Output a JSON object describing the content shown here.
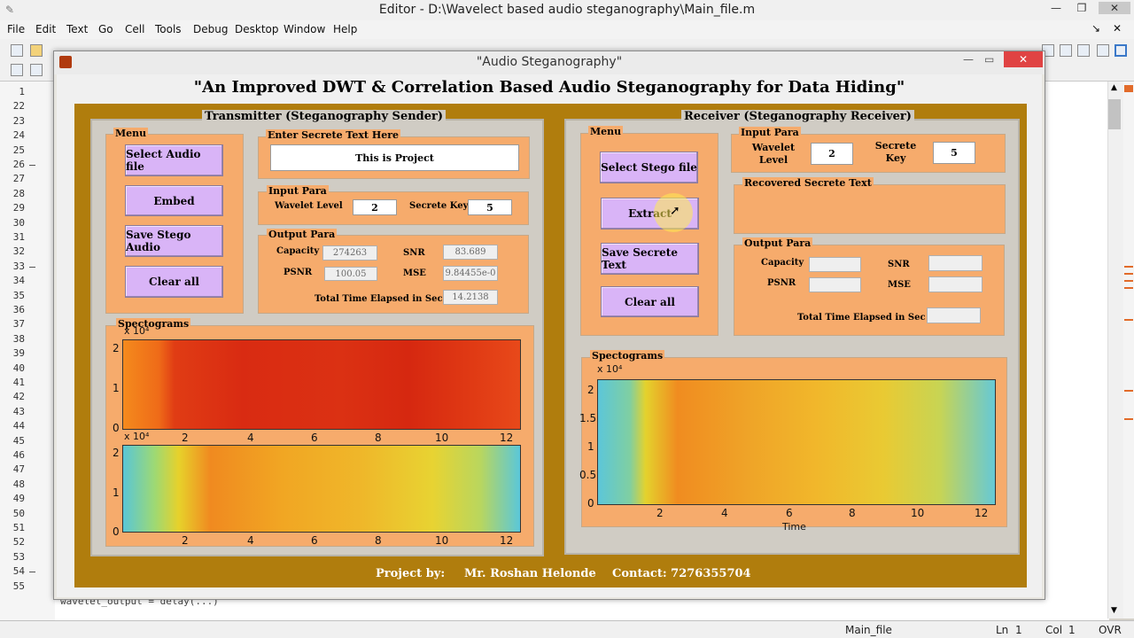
{
  "editor": {
    "title": "Editor - D:\\Wavelect based audio steganography\\Main_file.m",
    "menu": [
      "File",
      "Edit",
      "Text",
      "Go",
      "Cell",
      "Tools",
      "Debug",
      "Desktop",
      "Window",
      "Help"
    ],
    "line_numbers": [
      "1",
      "22",
      "23",
      "24",
      "25",
      "26",
      "27",
      "28",
      "29",
      "30",
      "31",
      "32",
      "33",
      "34",
      "35",
      "36",
      "37",
      "38",
      "39",
      "40",
      "41",
      "42",
      "43",
      "44",
      "45",
      "46",
      "47",
      "48",
      "49",
      "50",
      "51",
      "52",
      "53",
      "54",
      "55"
    ],
    "code_fragment": "wavelet_output = delay(...)",
    "status": {
      "file": "Main_file",
      "ln_label": "Ln",
      "ln": "1",
      "col_label": "Col",
      "col": "1",
      "mode": "OVR"
    }
  },
  "figure": {
    "title": "\"Audio Steganography\"",
    "headline": "\"An Improved DWT & Correlation Based Audio Steganography for Data Hiding\""
  },
  "transmitter": {
    "title": "Transmitter (Steganography Sender)",
    "menu_title": "Menu",
    "buttons": [
      "Select Audio file",
      "Embed",
      "Save Stego Audio",
      "Clear all"
    ],
    "secret_title": "Enter Secrete Text Here",
    "secret_text": "This is Project",
    "input_title": "Input Para",
    "wavelet_label": "Wavelet Level",
    "wavelet_value": "2",
    "key_label": "Secrete Key",
    "key_value": "5",
    "output_title": "Output Para",
    "capacity_label": "Capacity",
    "capacity_value": "274263",
    "snr_label": "SNR",
    "snr_value": "83.689",
    "psnr_label": "PSNR",
    "psnr_value": "100.05",
    "mse_label": "MSE",
    "mse_value": "9.84455e-0",
    "time_label": "Total Time Elapsed in Sec",
    "time_value": "14.2138",
    "spec_title": "Spectograms",
    "spec_exponent": "x 10⁴",
    "spec_y_ticks": [
      "2",
      "1",
      "0"
    ],
    "spec_x_ticks": [
      "2",
      "4",
      "6",
      "8",
      "10",
      "12"
    ]
  },
  "receiver": {
    "title": "Receiver (Steganography Receiver)",
    "menu_title": "Menu",
    "buttons": [
      "Select Stego file",
      "Extract",
      "Save Secrete Text",
      "Clear all"
    ],
    "input_title": "Input Para",
    "wavelet_label": "Wavelet Level",
    "wavelet_value": "2",
    "key_label": "Secrete Key",
    "key_value": "5",
    "recovered_title": "Recovered Secrete Text",
    "recovered_text": "",
    "output_title": "Output Para",
    "capacity_label": "Capacity",
    "snr_label": "SNR",
    "psnr_label": "PSNR",
    "mse_label": "MSE",
    "time_label": "Total Time Elapsed in Sec",
    "spec_title": "Spectograms",
    "spec_exponent": "x 10⁴",
    "spec_y_ticks": [
      "2",
      "1.5",
      "1",
      "0.5",
      "0"
    ],
    "spec_x_ticks": [
      "2",
      "4",
      "6",
      "8",
      "10",
      "12"
    ],
    "spec_xlabel": "Time"
  },
  "footer": {
    "project_label": "Project by:",
    "author": "Mr. Roshan Helonde",
    "contact": "Contact: 7276355704"
  },
  "colors": {
    "gold_frame": "#b07d0d",
    "orange_panel": "#f6ab6c",
    "purple_button": "#d9b4f7",
    "close_button": "#e04343"
  }
}
